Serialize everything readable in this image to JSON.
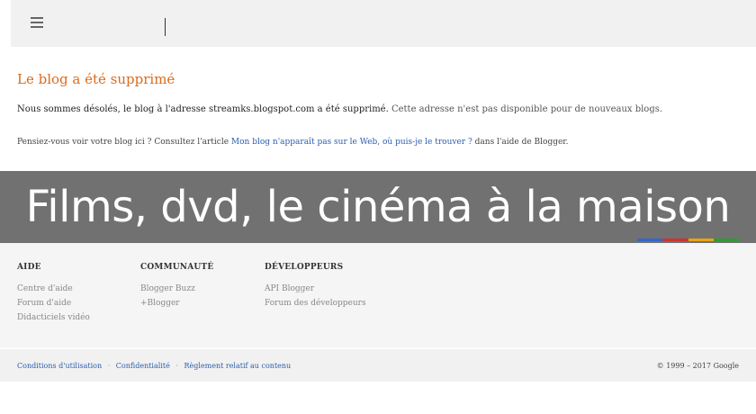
{
  "header": {
    "menu_icon": "hamburger-icon"
  },
  "error": {
    "title": "Le blog a été supprimé",
    "message_main": "Nous sommes désolés, le blog à l'adresse streamks.blogspot.com a été supprimé.",
    "message_note": "Cette adresse n'est pas disponible pour de nouveaux blogs.",
    "help_prefix": "Pensiez-vous voir votre blog ici ? Consultez l'article",
    "help_link": "Mon blog n'apparaît pas sur le Web, où puis-je le trouver ?",
    "help_suffix": "dans l'aide de Blogger."
  },
  "overlay": {
    "text": "Films, dvd, le cinéma à la maison"
  },
  "colors": {
    "accent_title": "#dd6a1b",
    "link": "#2a5db0",
    "brand_bar": [
      "#3366cc",
      "#cc3333",
      "#e8a317",
      "#339933"
    ]
  },
  "footer": {
    "columns": [
      {
        "heading": "AIDE",
        "links": [
          "Centre d'aide",
          "Forum d'aide",
          "Didacticiels vidéo"
        ]
      },
      {
        "heading": "COMMUNAUTÉ",
        "links": [
          "Blogger Buzz",
          "+Blogger"
        ]
      },
      {
        "heading": "DÉVELOPPEURS",
        "links": [
          "API Blogger",
          "Forum des développeurs"
        ]
      }
    ],
    "bottom_links": [
      "Conditions d'utilisation",
      "Confidentialité",
      "Règlement relatif au contenu"
    ],
    "separator": "·",
    "copyright": "© 1999 – 2017 Google"
  }
}
